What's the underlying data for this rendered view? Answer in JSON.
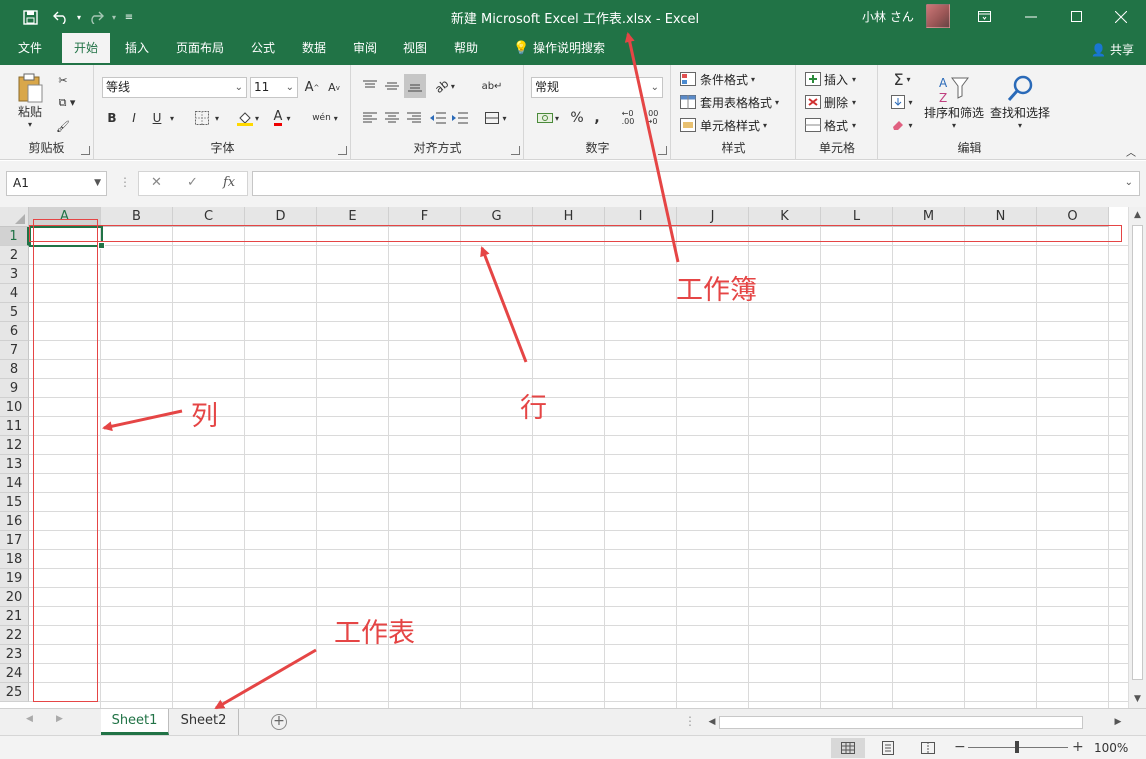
{
  "title_bar": {
    "title": "新建 Microsoft Excel 工作表.xlsx  -  Excel",
    "user": "小林 さん",
    "icons": [
      "save-icon",
      "undo-icon",
      "redo-icon",
      "customize-qat-icon",
      "ribbon-display-options-icon",
      "minimize-icon",
      "maximize-icon",
      "close-icon"
    ]
  },
  "menu": {
    "tabs": [
      "文件",
      "开始",
      "插入",
      "页面布局",
      "公式",
      "数据",
      "审阅",
      "视图",
      "帮助"
    ],
    "active_tab": "开始",
    "tell_me": "操作说明搜索",
    "share": "共享"
  },
  "ribbon": {
    "clipboard": {
      "label": "剪贴板",
      "paste": "粘贴"
    },
    "font": {
      "label": "字体",
      "font_name": "等线",
      "font_size": "11",
      "bold": "B",
      "italic": "I",
      "underline": "U",
      "font_color_letter": "A",
      "phonetic": "wén"
    },
    "alignment": {
      "label": "对齐方式"
    },
    "number": {
      "label": "数字",
      "format": "常规",
      "percent": "%",
      "comma": ","
    },
    "styles": {
      "label": "样式",
      "conditional": "条件格式",
      "table": "套用表格格式",
      "cell_styles": "单元格样式"
    },
    "cells": {
      "label": "单元格",
      "insert": "插入",
      "delete": "删除",
      "format": "格式"
    },
    "editing": {
      "label": "编辑",
      "sort_filter": "排序和筛选",
      "find_select": "查找和选择"
    }
  },
  "formula_bar": {
    "name_box": "A1",
    "fx": "fx",
    "cancel": "✕",
    "enter": "✓",
    "value": ""
  },
  "grid": {
    "columns": [
      "A",
      "B",
      "C",
      "D",
      "E",
      "F",
      "G",
      "H",
      "I",
      "J",
      "K",
      "L",
      "M",
      "N",
      "O"
    ],
    "rows": [
      "1",
      "2",
      "3",
      "4",
      "5",
      "6",
      "7",
      "8",
      "9",
      "10",
      "11",
      "12",
      "13",
      "14",
      "15",
      "16",
      "17",
      "18",
      "19",
      "20",
      "21",
      "22",
      "23",
      "24",
      "25"
    ],
    "active_cell": "A1"
  },
  "sheets": {
    "tabs": [
      "Sheet1",
      "Sheet2"
    ],
    "active": "Sheet1",
    "add": "+"
  },
  "status_bar": {
    "zoom": "100%",
    "zoom_out": "−",
    "zoom_in": "+",
    "zoom_level_percent": 100
  },
  "annotations": {
    "workbook": "工作簿",
    "row": "行",
    "column": "列",
    "worksheet": "工作表"
  },
  "colors": {
    "accent": "#217346",
    "annotation": "#e54545"
  }
}
